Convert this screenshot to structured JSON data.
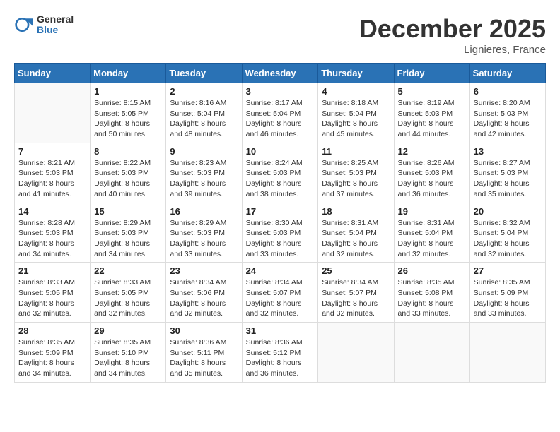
{
  "logo": {
    "general": "General",
    "blue": "Blue"
  },
  "header": {
    "month": "December 2025",
    "location": "Lignieres, France"
  },
  "weekdays": [
    "Sunday",
    "Monday",
    "Tuesday",
    "Wednesday",
    "Thursday",
    "Friday",
    "Saturday"
  ],
  "weeks": [
    [
      {
        "day": "",
        "info": ""
      },
      {
        "day": "1",
        "info": "Sunrise: 8:15 AM\nSunset: 5:05 PM\nDaylight: 8 hours\nand 50 minutes."
      },
      {
        "day": "2",
        "info": "Sunrise: 8:16 AM\nSunset: 5:04 PM\nDaylight: 8 hours\nand 48 minutes."
      },
      {
        "day": "3",
        "info": "Sunrise: 8:17 AM\nSunset: 5:04 PM\nDaylight: 8 hours\nand 46 minutes."
      },
      {
        "day": "4",
        "info": "Sunrise: 8:18 AM\nSunset: 5:04 PM\nDaylight: 8 hours\nand 45 minutes."
      },
      {
        "day": "5",
        "info": "Sunrise: 8:19 AM\nSunset: 5:03 PM\nDaylight: 8 hours\nand 44 minutes."
      },
      {
        "day": "6",
        "info": "Sunrise: 8:20 AM\nSunset: 5:03 PM\nDaylight: 8 hours\nand 42 minutes."
      }
    ],
    [
      {
        "day": "7",
        "info": "Sunrise: 8:21 AM\nSunset: 5:03 PM\nDaylight: 8 hours\nand 41 minutes."
      },
      {
        "day": "8",
        "info": "Sunrise: 8:22 AM\nSunset: 5:03 PM\nDaylight: 8 hours\nand 40 minutes."
      },
      {
        "day": "9",
        "info": "Sunrise: 8:23 AM\nSunset: 5:03 PM\nDaylight: 8 hours\nand 39 minutes."
      },
      {
        "day": "10",
        "info": "Sunrise: 8:24 AM\nSunset: 5:03 PM\nDaylight: 8 hours\nand 38 minutes."
      },
      {
        "day": "11",
        "info": "Sunrise: 8:25 AM\nSunset: 5:03 PM\nDaylight: 8 hours\nand 37 minutes."
      },
      {
        "day": "12",
        "info": "Sunrise: 8:26 AM\nSunset: 5:03 PM\nDaylight: 8 hours\nand 36 minutes."
      },
      {
        "day": "13",
        "info": "Sunrise: 8:27 AM\nSunset: 5:03 PM\nDaylight: 8 hours\nand 35 minutes."
      }
    ],
    [
      {
        "day": "14",
        "info": "Sunrise: 8:28 AM\nSunset: 5:03 PM\nDaylight: 8 hours\nand 34 minutes."
      },
      {
        "day": "15",
        "info": "Sunrise: 8:29 AM\nSunset: 5:03 PM\nDaylight: 8 hours\nand 34 minutes."
      },
      {
        "day": "16",
        "info": "Sunrise: 8:29 AM\nSunset: 5:03 PM\nDaylight: 8 hours\nand 33 minutes."
      },
      {
        "day": "17",
        "info": "Sunrise: 8:30 AM\nSunset: 5:03 PM\nDaylight: 8 hours\nand 33 minutes."
      },
      {
        "day": "18",
        "info": "Sunrise: 8:31 AM\nSunset: 5:04 PM\nDaylight: 8 hours\nand 32 minutes."
      },
      {
        "day": "19",
        "info": "Sunrise: 8:31 AM\nSunset: 5:04 PM\nDaylight: 8 hours\nand 32 minutes."
      },
      {
        "day": "20",
        "info": "Sunrise: 8:32 AM\nSunset: 5:04 PM\nDaylight: 8 hours\nand 32 minutes."
      }
    ],
    [
      {
        "day": "21",
        "info": "Sunrise: 8:33 AM\nSunset: 5:05 PM\nDaylight: 8 hours\nand 32 minutes."
      },
      {
        "day": "22",
        "info": "Sunrise: 8:33 AM\nSunset: 5:05 PM\nDaylight: 8 hours\nand 32 minutes."
      },
      {
        "day": "23",
        "info": "Sunrise: 8:34 AM\nSunset: 5:06 PM\nDaylight: 8 hours\nand 32 minutes."
      },
      {
        "day": "24",
        "info": "Sunrise: 8:34 AM\nSunset: 5:07 PM\nDaylight: 8 hours\nand 32 minutes."
      },
      {
        "day": "25",
        "info": "Sunrise: 8:34 AM\nSunset: 5:07 PM\nDaylight: 8 hours\nand 32 minutes."
      },
      {
        "day": "26",
        "info": "Sunrise: 8:35 AM\nSunset: 5:08 PM\nDaylight: 8 hours\nand 33 minutes."
      },
      {
        "day": "27",
        "info": "Sunrise: 8:35 AM\nSunset: 5:09 PM\nDaylight: 8 hours\nand 33 minutes."
      }
    ],
    [
      {
        "day": "28",
        "info": "Sunrise: 8:35 AM\nSunset: 5:09 PM\nDaylight: 8 hours\nand 34 minutes."
      },
      {
        "day": "29",
        "info": "Sunrise: 8:35 AM\nSunset: 5:10 PM\nDaylight: 8 hours\nand 34 minutes."
      },
      {
        "day": "30",
        "info": "Sunrise: 8:36 AM\nSunset: 5:11 PM\nDaylight: 8 hours\nand 35 minutes."
      },
      {
        "day": "31",
        "info": "Sunrise: 8:36 AM\nSunset: 5:12 PM\nDaylight: 8 hours\nand 36 minutes."
      },
      {
        "day": "",
        "info": ""
      },
      {
        "day": "",
        "info": ""
      },
      {
        "day": "",
        "info": ""
      }
    ]
  ]
}
